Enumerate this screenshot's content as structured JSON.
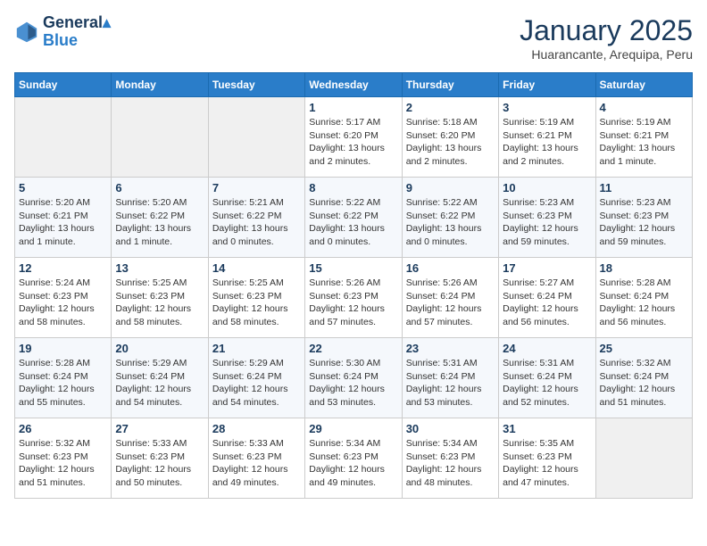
{
  "header": {
    "logo_line1": "General",
    "logo_line2": "Blue",
    "month": "January 2025",
    "location": "Huarancante, Arequipa, Peru"
  },
  "weekdays": [
    "Sunday",
    "Monday",
    "Tuesday",
    "Wednesday",
    "Thursday",
    "Friday",
    "Saturday"
  ],
  "weeks": [
    [
      {
        "day": "",
        "info": ""
      },
      {
        "day": "",
        "info": ""
      },
      {
        "day": "",
        "info": ""
      },
      {
        "day": "1",
        "info": "Sunrise: 5:17 AM\nSunset: 6:20 PM\nDaylight: 13 hours and 2 minutes."
      },
      {
        "day": "2",
        "info": "Sunrise: 5:18 AM\nSunset: 6:20 PM\nDaylight: 13 hours and 2 minutes."
      },
      {
        "day": "3",
        "info": "Sunrise: 5:19 AM\nSunset: 6:21 PM\nDaylight: 13 hours and 2 minutes."
      },
      {
        "day": "4",
        "info": "Sunrise: 5:19 AM\nSunset: 6:21 PM\nDaylight: 13 hours and 1 minute."
      }
    ],
    [
      {
        "day": "5",
        "info": "Sunrise: 5:20 AM\nSunset: 6:21 PM\nDaylight: 13 hours and 1 minute."
      },
      {
        "day": "6",
        "info": "Sunrise: 5:20 AM\nSunset: 6:22 PM\nDaylight: 13 hours and 1 minute."
      },
      {
        "day": "7",
        "info": "Sunrise: 5:21 AM\nSunset: 6:22 PM\nDaylight: 13 hours and 0 minutes."
      },
      {
        "day": "8",
        "info": "Sunrise: 5:22 AM\nSunset: 6:22 PM\nDaylight: 13 hours and 0 minutes."
      },
      {
        "day": "9",
        "info": "Sunrise: 5:22 AM\nSunset: 6:22 PM\nDaylight: 13 hours and 0 minutes."
      },
      {
        "day": "10",
        "info": "Sunrise: 5:23 AM\nSunset: 6:23 PM\nDaylight: 12 hours and 59 minutes."
      },
      {
        "day": "11",
        "info": "Sunrise: 5:23 AM\nSunset: 6:23 PM\nDaylight: 12 hours and 59 minutes."
      }
    ],
    [
      {
        "day": "12",
        "info": "Sunrise: 5:24 AM\nSunset: 6:23 PM\nDaylight: 12 hours and 58 minutes."
      },
      {
        "day": "13",
        "info": "Sunrise: 5:25 AM\nSunset: 6:23 PM\nDaylight: 12 hours and 58 minutes."
      },
      {
        "day": "14",
        "info": "Sunrise: 5:25 AM\nSunset: 6:23 PM\nDaylight: 12 hours and 58 minutes."
      },
      {
        "day": "15",
        "info": "Sunrise: 5:26 AM\nSunset: 6:23 PM\nDaylight: 12 hours and 57 minutes."
      },
      {
        "day": "16",
        "info": "Sunrise: 5:26 AM\nSunset: 6:24 PM\nDaylight: 12 hours and 57 minutes."
      },
      {
        "day": "17",
        "info": "Sunrise: 5:27 AM\nSunset: 6:24 PM\nDaylight: 12 hours and 56 minutes."
      },
      {
        "day": "18",
        "info": "Sunrise: 5:28 AM\nSunset: 6:24 PM\nDaylight: 12 hours and 56 minutes."
      }
    ],
    [
      {
        "day": "19",
        "info": "Sunrise: 5:28 AM\nSunset: 6:24 PM\nDaylight: 12 hours and 55 minutes."
      },
      {
        "day": "20",
        "info": "Sunrise: 5:29 AM\nSunset: 6:24 PM\nDaylight: 12 hours and 54 minutes."
      },
      {
        "day": "21",
        "info": "Sunrise: 5:29 AM\nSunset: 6:24 PM\nDaylight: 12 hours and 54 minutes."
      },
      {
        "day": "22",
        "info": "Sunrise: 5:30 AM\nSunset: 6:24 PM\nDaylight: 12 hours and 53 minutes."
      },
      {
        "day": "23",
        "info": "Sunrise: 5:31 AM\nSunset: 6:24 PM\nDaylight: 12 hours and 53 minutes."
      },
      {
        "day": "24",
        "info": "Sunrise: 5:31 AM\nSunset: 6:24 PM\nDaylight: 12 hours and 52 minutes."
      },
      {
        "day": "25",
        "info": "Sunrise: 5:32 AM\nSunset: 6:24 PM\nDaylight: 12 hours and 51 minutes."
      }
    ],
    [
      {
        "day": "26",
        "info": "Sunrise: 5:32 AM\nSunset: 6:23 PM\nDaylight: 12 hours and 51 minutes."
      },
      {
        "day": "27",
        "info": "Sunrise: 5:33 AM\nSunset: 6:23 PM\nDaylight: 12 hours and 50 minutes."
      },
      {
        "day": "28",
        "info": "Sunrise: 5:33 AM\nSunset: 6:23 PM\nDaylight: 12 hours and 49 minutes."
      },
      {
        "day": "29",
        "info": "Sunrise: 5:34 AM\nSunset: 6:23 PM\nDaylight: 12 hours and 49 minutes."
      },
      {
        "day": "30",
        "info": "Sunrise: 5:34 AM\nSunset: 6:23 PM\nDaylight: 12 hours and 48 minutes."
      },
      {
        "day": "31",
        "info": "Sunrise: 5:35 AM\nSunset: 6:23 PM\nDaylight: 12 hours and 47 minutes."
      },
      {
        "day": "",
        "info": ""
      }
    ]
  ]
}
